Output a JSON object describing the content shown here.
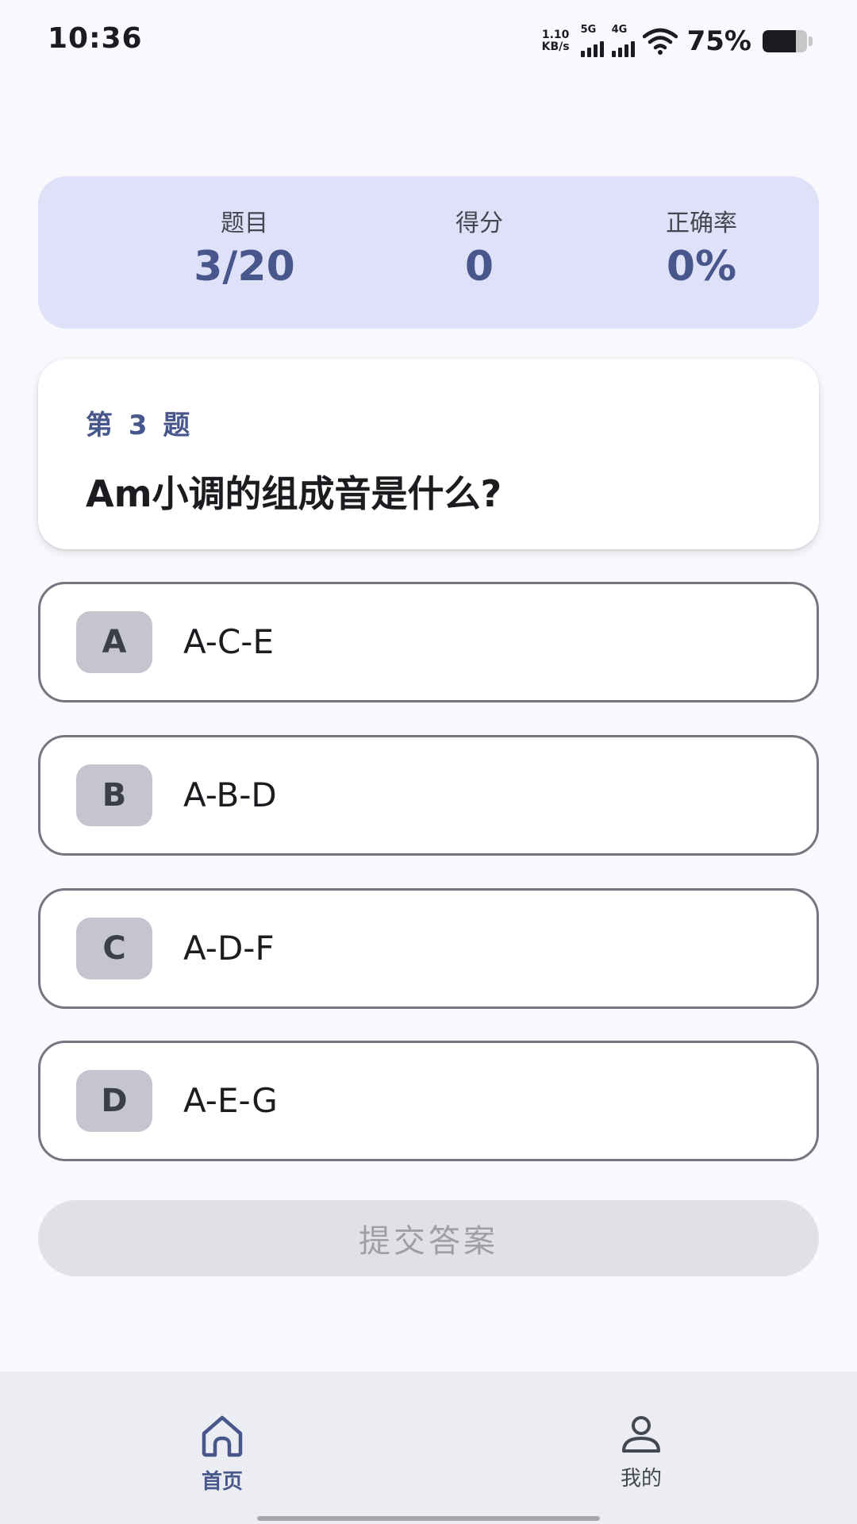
{
  "status_bar": {
    "time": "10:36",
    "net_speed_value": "1.10",
    "net_speed_unit": "KB/s",
    "signal_1_tag": "5G",
    "signal_2_tag": "4G",
    "battery_percent": "75%",
    "battery_level": 0.75,
    "icons": [
      "signal-5g-icon",
      "signal-4g-icon",
      "wifi-icon",
      "battery-icon"
    ]
  },
  "stats": {
    "question_label": "题目",
    "question_value": "3/20",
    "score_label": "得分",
    "score_value": "0",
    "accuracy_label": "正确率",
    "accuracy_value": "0%"
  },
  "question": {
    "number_label": "第 3 题",
    "text": "Am小调的组成音是什么?"
  },
  "options": [
    {
      "letter": "A",
      "text": "A-C-E"
    },
    {
      "letter": "B",
      "text": "A-B-D"
    },
    {
      "letter": "C",
      "text": "A-D-F"
    },
    {
      "letter": "D",
      "text": "A-E-G"
    }
  ],
  "submit": {
    "label": "提交答案",
    "enabled": false
  },
  "bottom_nav": {
    "items": [
      {
        "label": "首页",
        "icon": "home-icon",
        "active": true
      },
      {
        "label": "我的",
        "icon": "person-icon",
        "active": false
      }
    ]
  },
  "colors": {
    "accent": "#48578b",
    "stats_background": "#dfe1f9",
    "page_background": "#f8f8fd",
    "option_border": "#74777f",
    "badge_background": "#c4c5cf",
    "nav_background": "#ececf3",
    "disabled_button": "#e0e0e6"
  }
}
